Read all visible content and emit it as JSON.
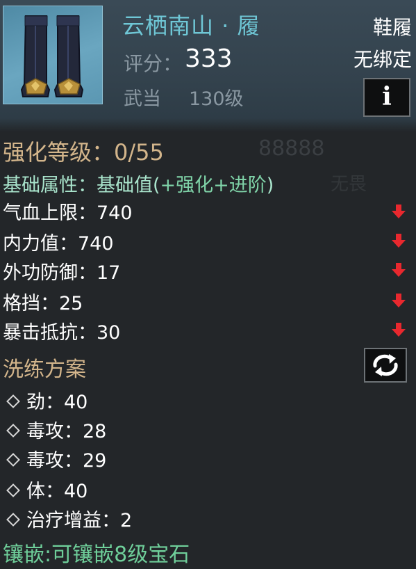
{
  "item": {
    "name": "云栖南山 · 履",
    "score_label": "评分：",
    "score": "333",
    "school": "武当",
    "level": "130级",
    "type": "鞋履",
    "bind": "无绑定",
    "info_button": "i",
    "icon": "boots-icon"
  },
  "watermark": {
    "number": "88888",
    "text": "无畏"
  },
  "enhance": {
    "label": "强化等级：0/55"
  },
  "base_attrs": {
    "header_prefix": "基础属性：基础值(",
    "header_bonus": "+强化+进阶",
    "header_suffix": ")",
    "rows": [
      {
        "label": "气血上限：740",
        "trend": "down",
        "arrow_color": "#e8282e"
      },
      {
        "label": "内力值：740",
        "trend": "down",
        "arrow_color": "#e8282e"
      },
      {
        "label": "外功防御：17",
        "trend": "down",
        "arrow_color": "#e8282e"
      },
      {
        "label": "格挡：25",
        "trend": "down",
        "arrow_color": "#e8282e"
      },
      {
        "label": "暴击抵抗：30",
        "trend": "down",
        "arrow_color": "#e8282e"
      }
    ]
  },
  "wash": {
    "title": "洗练方案",
    "refresh_icon": "refresh-icon",
    "rows": [
      {
        "label": "劲：40"
      },
      {
        "label": "毒攻：28"
      },
      {
        "label": "毒攻：29"
      },
      {
        "label": "体：40"
      },
      {
        "label": "治疗增益：2"
      }
    ]
  },
  "gem": {
    "label": "镶嵌:可镶嵌8级宝石"
  }
}
